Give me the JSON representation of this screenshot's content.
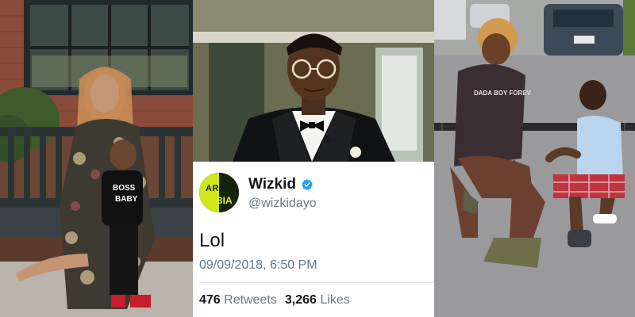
{
  "tweet": {
    "display_name": "Wizkid",
    "handle": "@wizkidayo",
    "text": "Lol",
    "timestamp": "09/09/2018, 6:50 PM",
    "retweets_count": "476",
    "retweets_label": "Retweets",
    "likes_count": "3,266",
    "likes_label": "Likes",
    "avatar_text_top": "ARR",
    "avatar_text_bottom": "BIA",
    "verified_icon": "verified-badge-icon",
    "colors": {
      "verified": "#1da1f2",
      "secondary_text": "#657786",
      "primary_text": "#14171a"
    }
  },
  "photos": {
    "left_shirt_text_1": "BOSS",
    "left_shirt_text_2": "BABY",
    "right_shirt_text": "DADA BOY FOREV"
  }
}
